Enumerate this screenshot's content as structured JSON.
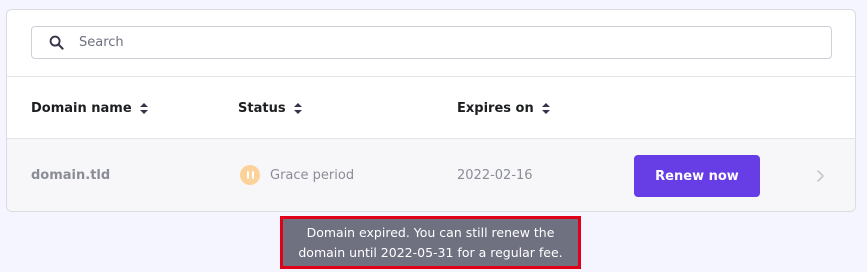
{
  "search": {
    "placeholder": "Search",
    "value": ""
  },
  "table": {
    "columns": [
      {
        "label": "Domain name",
        "sortable": true
      },
      {
        "label": "Status",
        "sortable": true
      },
      {
        "label": "Expires on",
        "sortable": true
      }
    ],
    "rows": [
      {
        "domain": "domain.tld",
        "status": "Grace period",
        "status_icon": "pause-icon",
        "expires": "2022-02-16",
        "action_label": "Renew now"
      }
    ]
  },
  "tooltip": {
    "line1": "Domain expired. You can still renew the",
    "line2": "domain until 2022-05-31 for a regular fee."
  },
  "colors": {
    "accent": "#673de6",
    "status_warning": "#fbd39a",
    "tooltip_bg": "#6f7181",
    "highlight_border": "#e0001a"
  }
}
